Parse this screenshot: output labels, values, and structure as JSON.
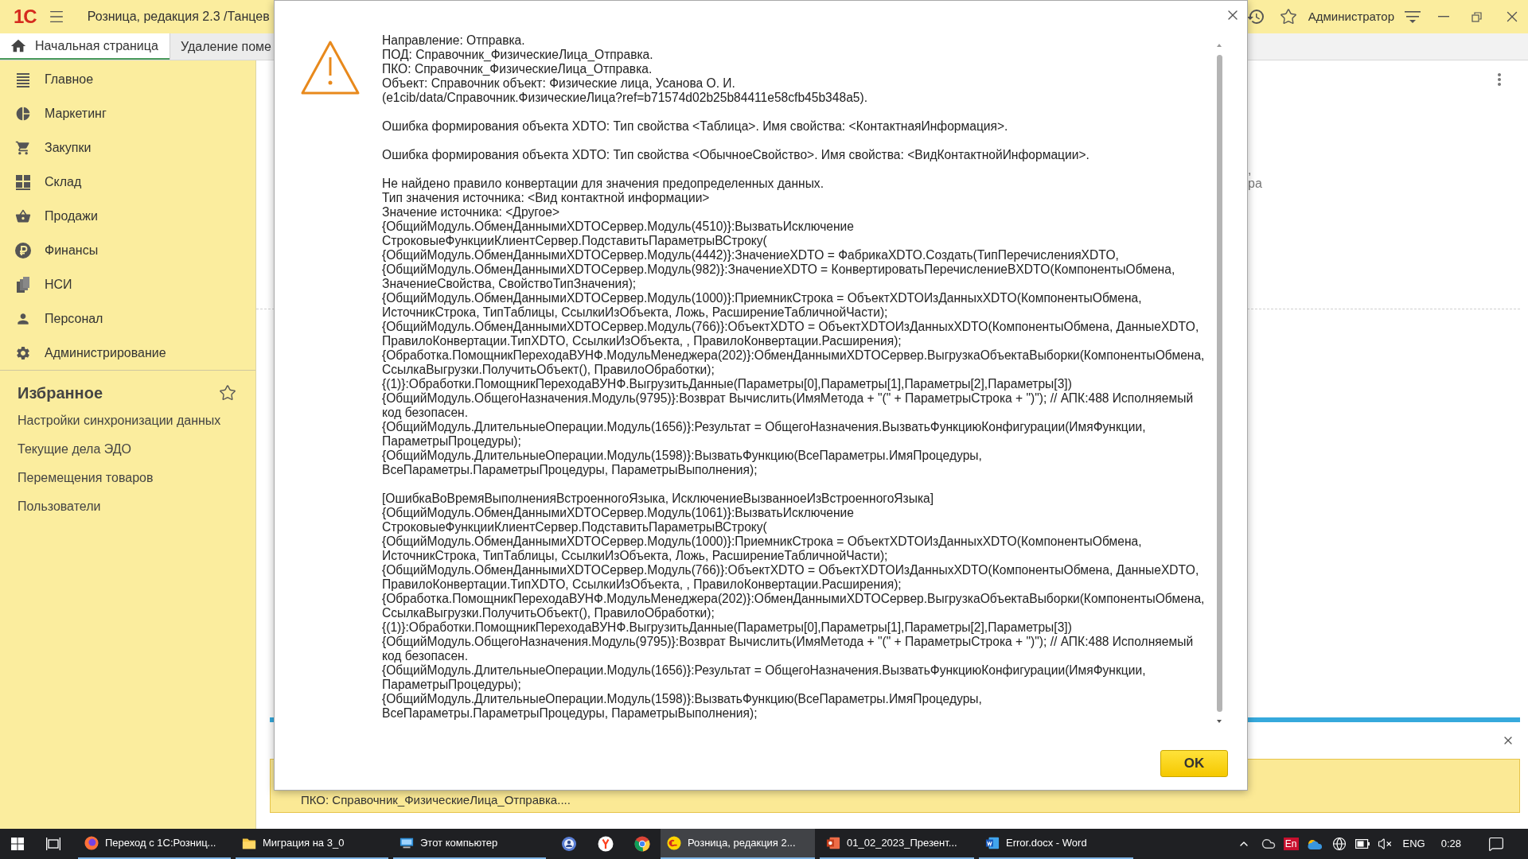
{
  "app_bar": {
    "logo": "1С",
    "title": "Розница, редакция 2.3 /Танцев",
    "user": "Администратор"
  },
  "tabs": [
    {
      "label": "Начальная страница",
      "selected": true
    },
    {
      "label": "Удаление поме",
      "selected": false
    }
  ],
  "sidebar": {
    "sections": [
      {
        "label": "Главное"
      },
      {
        "label": "Маркетинг"
      },
      {
        "label": "Закупки"
      },
      {
        "label": "Склад"
      },
      {
        "label": "Продажи"
      },
      {
        "label": "Финансы"
      },
      {
        "label": "НСИ"
      },
      {
        "label": "Персонал"
      },
      {
        "label": "Администрирование"
      }
    ],
    "favorites": {
      "title": "Избранное",
      "items": [
        "Настройки синхронизации данных",
        "Текущие дела ЭДО",
        "Перемещения товаров",
        "Пользователи"
      ]
    }
  },
  "content": {
    "text_fragments": [
      ",",
      "ра"
    ],
    "progress": {
      "level": 1
    },
    "notification": {
      "text": "ПКО: Справочник_ФизическиеЛица_Отправка...."
    }
  },
  "dialog": {
    "message_blocks": [
      {
        "lines": [
          "Направление: Отправка.",
          "ПОД: Справочник_ФизическиеЛица_Отправка.",
          "ПКО: Справочник_ФизическиеЛица_Отправка.",
          "Объект: Справочник объект: Физические лица, Усанова О. И.",
          "(e1cib/data/Справочник.ФизическиеЛица?ref=b71574d02b25b84411e58cfb45b348a5)."
        ]
      },
      {
        "lines": [
          "Ошибка формирования объекта XDTO: Тип свойства <Таблица>. Имя свойства: <КонтактнаяИнформация>."
        ]
      },
      {
        "lines": [
          "Ошибка формирования объекта XDTO: Тип свойства <ОбычноеСвойство>. Имя свойства: <ВидКонтактнойИнформации>."
        ]
      },
      {
        "lines": [
          "Не найдено правило конвертации для значения предопределенных данных.",
          "Тип значения источника: <Вид контактной информации>",
          "Значение источника: <Другое>",
          "{ОбщийМодуль.ОбменДаннымиXDTOСервер.Модуль(4510)}:ВызватьИсключение",
          "СтроковыеФункцииКлиентСервер.ПодставитьПараметрыВСтроку(",
          "{ОбщийМодуль.ОбменДаннымиXDTOСервер.Модуль(4442)}:ЗначениеXDTO = ФабрикаXDTO.Создать(ТипПеречисленияXDTO,",
          "{ОбщийМодуль.ОбменДаннымиXDTOСервер.Модуль(982)}:ЗначениеXDTO = КонвертироватьПеречислениеВXDTO(КомпонентыОбмена,",
          "ЗначениеСвойства, СвойствоТипЗначения);",
          "{ОбщийМодуль.ОбменДаннымиXDTOСервер.Модуль(1000)}:ПриемникСтрока = ОбъектXDTOИзДанныхXDTO(КомпонентыОбмена,",
          "ИсточникСтрока, ТипТаблицы, СсылкиИзОбъекта, Ложь, РасширениеТабличнойЧасти);",
          "{ОбщийМодуль.ОбменДаннымиXDTOСервер.Модуль(766)}:ОбъектXDTO = ОбъектXDTOИзДанныхXDTO(КомпонентыОбмена, ДанныеXDTO,",
          "ПравилоКонвертации.ТипXDTO, СсылкиИзОбъекта, , ПравилоКонвертации.Расширения);",
          "{Обработка.ПомощникПереходаВУНФ.МодульМенеджера(202)}:ОбменДаннымиXDTOСервер.ВыгрузкаОбъектаВыборки(КомпонентыОбмена,",
          "СсылкаВыгрузки.ПолучитьОбъект(), ПравилоОбработки);",
          "{(1)}:Обработки.ПомощникПереходаВУНФ.ВыгрузитьДанные(Параметры[0],Параметры[1],Параметры[2],Параметры[3])",
          "{ОбщийМодуль.ОбщегоНазначения.Модуль(9795)}:Возврат Вычислить(ИмяМетода + \"(\" + ПараметрыСтрока + \")\"); // АПК:488 Исполняемый",
          "код безопасен.",
          "{ОбщийМодуль.ДлительныеОперации.Модуль(1656)}:Результат = ОбщегоНазначения.ВызватьФункциюКонфигурации(ИмяФункции,",
          "ПараметрыПроцедуры);",
          "{ОбщийМодуль.ДлительныеОперации.Модуль(1598)}:ВызватьФункцию(ВсеПараметры.ИмяПроцедуры,",
          "ВсеПараметры.ПараметрыПроцедуры, ПараметрыВыполнения);"
        ]
      },
      {
        "lines": [
          "[ОшибкаВоВремяВыполненияВстроенногоЯзыка, ИсключениеВызванноеИзВстроенногоЯзыка]",
          "{ОбщийМодуль.ОбменДаннымиXDTOСервер.Модуль(1061)}:ВызватьИсключение",
          "СтроковыеФункцииКлиентСервер.ПодставитьПараметрыВСтроку(",
          "{ОбщийМодуль.ОбменДаннымиXDTOСервер.Модуль(1000)}:ПриемникСтрока = ОбъектXDTOИзДанныхXDTO(КомпонентыОбмена,",
          "ИсточникСтрока, ТипТаблицы, СсылкиИзОбъекта, Ложь, РасширениеТабличнойЧасти);",
          "{ОбщийМодуль.ОбменДаннымиXDTOСервер.Модуль(766)}:ОбъектXDTO = ОбъектXDTOИзДанныхXDTO(КомпонентыОбмена, ДанныеXDTO,",
          "ПравилоКонвертации.ТипXDTO, СсылкиИзОбъекта, , ПравилоКонвертации.Расширения);",
          "{Обработка.ПомощникПереходаВУНФ.МодульМенеджера(202)}:ОбменДаннымиXDTOСервер.ВыгрузкаОбъектаВыборки(КомпонентыОбмена,",
          "СсылкаВыгрузки.ПолучитьОбъект(), ПравилоОбработки);",
          "{(1)}:Обработки.ПомощникПереходаВУНФ.ВыгрузитьДанные(Параметры[0],Параметры[1],Параметры[2],Параметры[3])",
          "{ОбщийМодуль.ОбщегоНазначения.Модуль(9795)}:Возврат Вычислить(ИмяМетода + \"(\" + ПараметрыСтрока + \")\"); // АПК:488 Исполняемый",
          "код безопасен.",
          "{ОбщийМодуль.ДлительныеОперации.Модуль(1656)}:Результат = ОбщегоНазначения.ВызватьФункциюКонфигурации(ИмяФункции,",
          "ПараметрыПроцедуры);",
          "{ОбщийМодуль.ДлительныеОперации.Модуль(1598)}:ВызватьФункцию(ВсеПараметры.ИмяПроцедуры,",
          "ВсеПараметры.ПараметрыПроцедуры, ПараметрыВыполнения);"
        ]
      }
    ],
    "buttons": [
      {
        "label": "OK"
      }
    ]
  },
  "taskbar": {
    "windows": [
      {
        "label": "Переход с 1С:Розниц...",
        "selected": false
      },
      {
        "label": "Миграция на 3_0",
        "selected": false
      },
      {
        "label": "Этот компьютер",
        "selected": false
      },
      {
        "label": "Розница, редакция 2...",
        "selected": true
      },
      {
        "label": "01_02_2023_Презент...",
        "selected": false
      },
      {
        "label": "Error.docx - Word",
        "selected": false
      }
    ],
    "tray": {
      "input_indicator": "En",
      "language": "ENG",
      "time": "0:28"
    }
  }
}
